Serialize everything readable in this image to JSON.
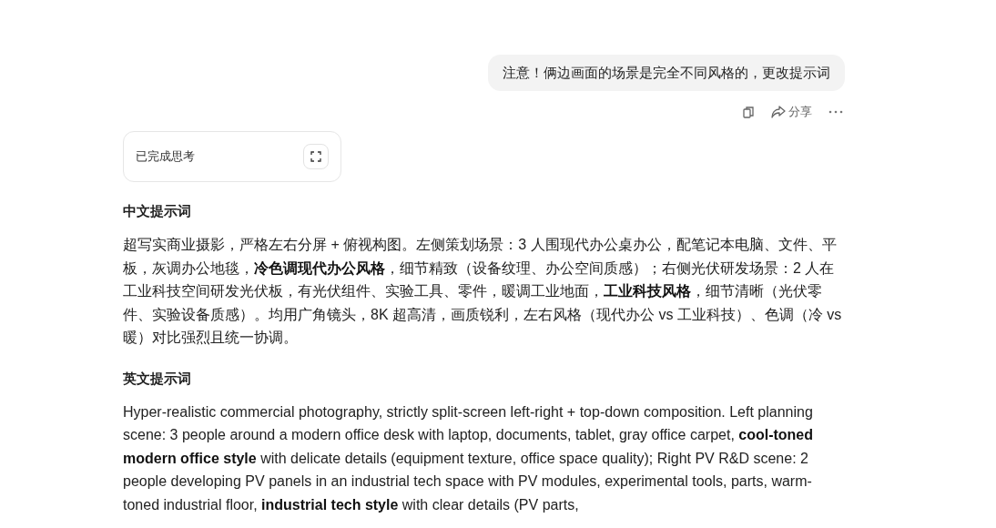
{
  "user_message": {
    "text": "注意！俩边画面的场景是完全不同风格的，更改提示词"
  },
  "message_actions": {
    "share_label": "分享"
  },
  "thinking": {
    "label": "已完成思考",
    "expanded": false
  },
  "sections": [
    {
      "heading": "中文提示词",
      "body": "超写实商业摄影，严格左右分屏 + 俯视构图。左侧策划场景：3 人围现代办公桌办公，配笔记本电脑、文件、平板，灰调办公地毯，**冷色调现代办公风格**，细节精致（设备纹理、办公空间质感）；右侧光伏研发场景：2 人在工业科技空间研发光伏板，有光伏组件、实验工具、零件，暖调工业地面，**工业科技风格**，细节清晰（光伏零件、实验设备质感）。均用广角镜头，8K 超高清，画质锐利，左右风格（现代办公 vs 工业科技）、色调（冷 vs 暖）对比强烈且统一协调。"
    },
    {
      "heading": "英文提示词",
      "body": "Hyper-realistic commercial photography, strictly split-screen left-right + top-down composition. Left planning scene: 3 people around a modern office desk with laptop, documents, tablet, gray office carpet, **cool-toned modern office style** with delicate details (equipment texture, office space quality); Right PV R&D scene: 2 people developing PV panels in an industrial tech space with PV modules, experimental tools, parts, warm-toned industrial floor, **industrial tech style** with clear details (PV parts,"
    }
  ]
}
